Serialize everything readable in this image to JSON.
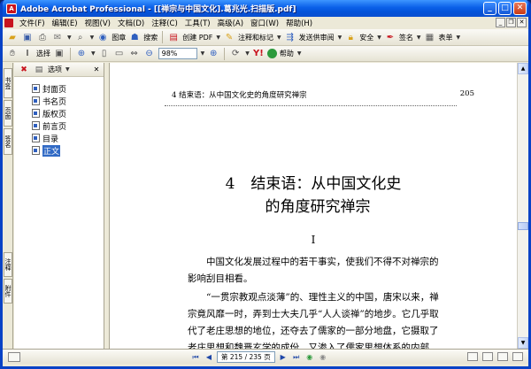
{
  "window": {
    "title": "Adobe Acrobat Professional - [[禅宗与中国文化].葛兆光.扫描版.pdf]",
    "app_icon": "A"
  },
  "menubar": {
    "items": [
      "文件(F)",
      "编辑(E)",
      "视图(V)",
      "文档(D)",
      "注释(C)",
      "工具(T)",
      "高级(A)",
      "窗口(W)",
      "帮助(H)"
    ]
  },
  "toolbar1": {
    "picture_label": "图章",
    "search_label": "搜索",
    "create_pdf_label": "创建 PDF",
    "comment_label": "注释和标记",
    "review_label": "发送供审阅",
    "security_label": "安全",
    "sign_label": "签名",
    "form_label": "表单"
  },
  "toolbar2": {
    "select_label": "选择",
    "zoom_value": "98%",
    "help_label": "帮助"
  },
  "tabs": {
    "bookmarks": "书签",
    "pages": "页面",
    "signatures": "签名",
    "comments": "注释",
    "attachments": "附件"
  },
  "panel": {
    "options_label": "选项",
    "bookmarks": [
      {
        "label": "封面页",
        "selected": false
      },
      {
        "label": "书名页",
        "selected": false
      },
      {
        "label": "版权页",
        "selected": false
      },
      {
        "label": "前言页",
        "selected": false
      },
      {
        "label": "目录",
        "selected": false
      },
      {
        "label": "正文",
        "selected": true
      }
    ]
  },
  "page": {
    "running_head_left": "4   结束语：从中国文化史的角度研究禅宗",
    "running_head_page": "205",
    "chapter_number": "4",
    "chapter_title_line1": "结束语：从中国文化史",
    "chapter_title_line2": "的角度研究禅宗",
    "ornament": "I",
    "para1_line1": "中国文化发展过程中的若干事实，使我们不得不对禅宗的",
    "para1_line2": "影响刮目相看。",
    "para2_line1": "“一贯宗教观点淡薄”的、理性主义的中国，唐宋以来，禅",
    "para2_line2": "宗竟风靡一时，弄到士大夫几乎“人人谈禅”的地步。它几乎取",
    "para2_line3": "代了老庄思想的地位，还夺去了儒家的一部分地盘，它摄取了",
    "para2_line4": "老庄思想和魏晋玄学的成份，又渗入了儒家思想体系的内部，由"
  },
  "status": {
    "page_display": "第 215 / 235 页"
  },
  "colors": {
    "titlebar": "#0453d9",
    "selection": "#316ac5",
    "acrobat_red": "#c8141e"
  }
}
